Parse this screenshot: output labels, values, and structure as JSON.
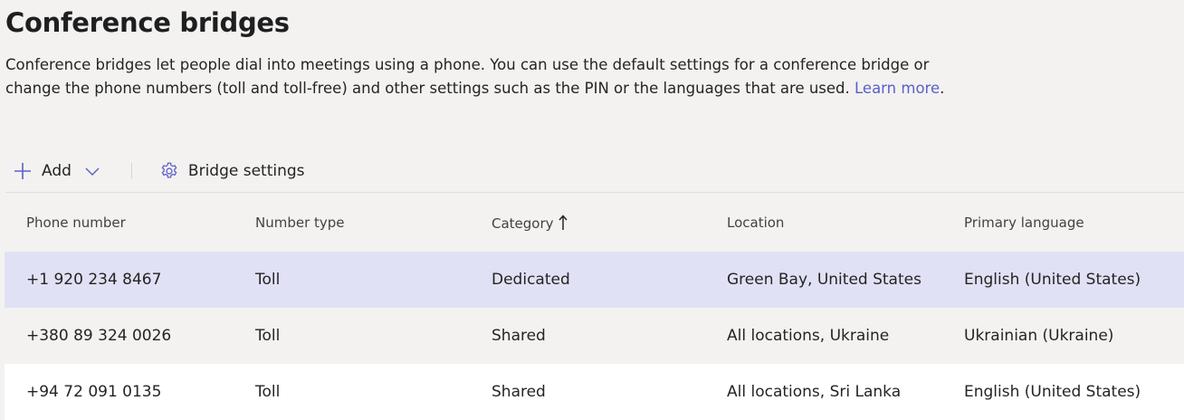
{
  "page": {
    "title": "Conference bridges",
    "description": "Conference bridges let people dial into meetings using a phone. You can use the default settings for a conference bridge or change the phone numbers (toll and toll-free) and other settings such as the PIN or the languages that are used. ",
    "learn_more": "Learn more",
    "learn_more_suffix": "."
  },
  "toolbar": {
    "add_label": "Add",
    "bridge_settings_label": "Bridge settings",
    "icons": [
      "plus-icon",
      "chevron-down-icon",
      "gear-icon"
    ]
  },
  "table": {
    "columns": [
      "Phone number",
      "Number type",
      "Category",
      "Location",
      "Primary language"
    ],
    "sorted_column": "Category",
    "sort_direction": "ascending",
    "rows": [
      {
        "phone": "+1 920 234 8467",
        "type": "Toll",
        "category": "Dedicated",
        "location": "Green Bay, United States",
        "language": "English (United States)",
        "selected": true
      },
      {
        "phone": "+380 89 324 0026",
        "type": "Toll",
        "category": "Shared",
        "location": "All locations, Ukraine",
        "language": "Ukrainian (Ukraine)",
        "selected": false
      },
      {
        "phone": "+94 72 091 0135",
        "type": "Toll",
        "category": "Shared",
        "location": "All locations, Sri Lanka",
        "language": "English (United States)",
        "selected": false
      }
    ]
  },
  "colors": {
    "accent": "#5b5fc7",
    "selected_row": "#e1e1f5",
    "background": "#f3f2f1"
  }
}
